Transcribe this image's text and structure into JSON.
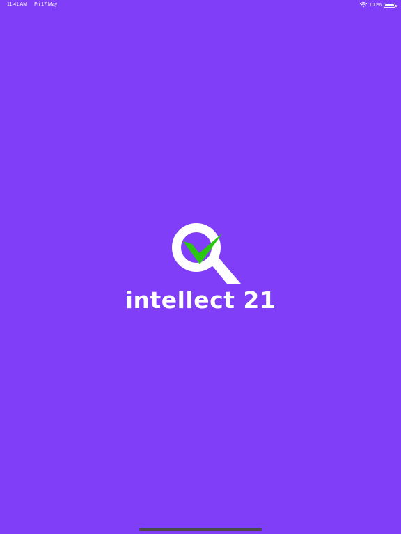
{
  "status_bar": {
    "time": "11:41 AM",
    "date": "Fri 17 May",
    "battery_text": "100%",
    "battery_level": 1.0,
    "icons": [
      "wifi-icon",
      "battery-icon"
    ]
  },
  "splash": {
    "brand_name": "intellect 21",
    "logo": "magnifier-with-checkmark-logo"
  },
  "colors": {
    "background": "#803ef8",
    "checkmark": "#2bc70e",
    "foreground": "#ffffff",
    "home_indicator": "#4a4a4a"
  }
}
